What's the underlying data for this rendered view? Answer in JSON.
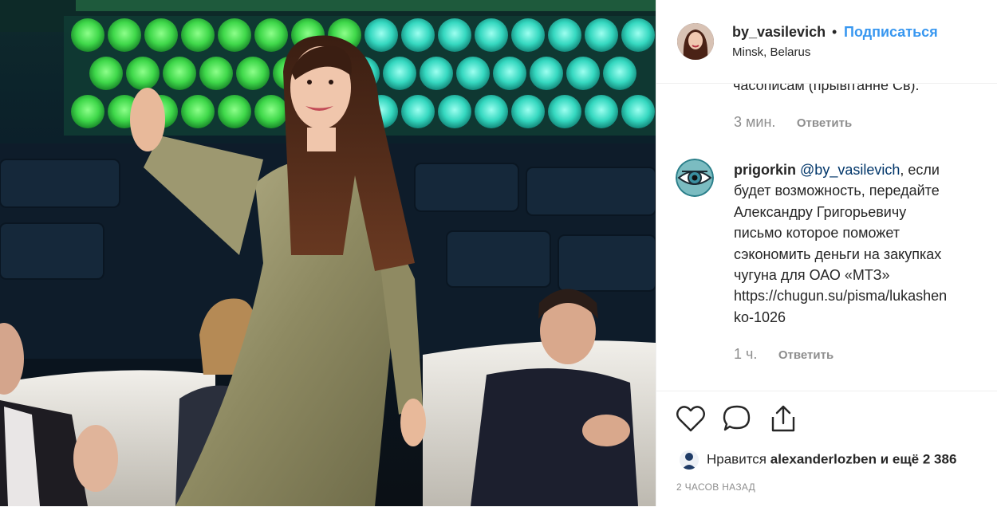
{
  "post": {
    "username": "by_vasilevich",
    "separator": "•",
    "follow_label": "Подписаться",
    "location": "Minsk, Belarus"
  },
  "comments": [
    {
      "partial_text": "часописам (прывітанне Св).",
      "time": "3 мин.",
      "reply_label": "Ответить"
    },
    {
      "username": "prigorkin",
      "mention": "@by_vasilevich",
      "lines": [
        ", если",
        "будет возможность, передайте",
        "Александру Григорьевичу",
        "письмо которое поможет",
        "сэкономить деньги на закупках",
        "чугуна для ОАО «МТЗ»",
        "https://chugun.su/pisma/lukashen",
        "ko-1026"
      ],
      "time": "1 ч.",
      "reply_label": "Ответить"
    }
  ],
  "actions": {
    "like_icon": "heart-icon",
    "comment_icon": "comment-icon",
    "share_icon": "share-icon"
  },
  "likes": {
    "prefix": "Нравится",
    "user": "alexanderlozben",
    "suffix": "и ещё 2 386"
  },
  "posted_ago": "2 ЧАСОВ НАЗАД"
}
